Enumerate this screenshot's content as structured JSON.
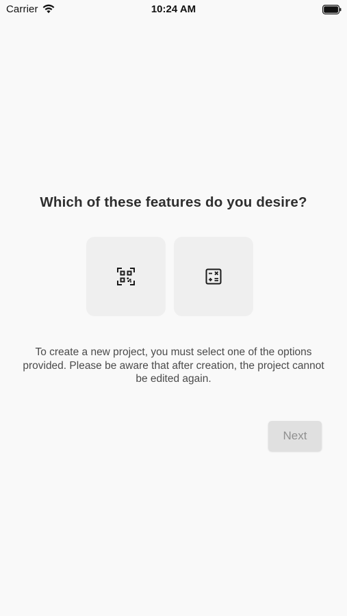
{
  "status_bar": {
    "carrier": "Carrier",
    "time": "10:24 AM",
    "wifi_icon": "wifi-icon",
    "battery_icon": "battery-icon"
  },
  "main": {
    "question": "Which of these features do you desire?",
    "options": [
      {
        "icon": "qr-code-scanner-icon"
      },
      {
        "icon": "calculator-icon"
      }
    ],
    "description": "To create a new project, you must select one of the options provided. Please be aware that after creation, the project cannot be edited again.",
    "next_label": "Next"
  },
  "colors": {
    "background": "#f9f9f9",
    "card": "#efefef",
    "button_disabled_bg": "#e0e0e0",
    "button_disabled_text": "#8f8f8f"
  }
}
